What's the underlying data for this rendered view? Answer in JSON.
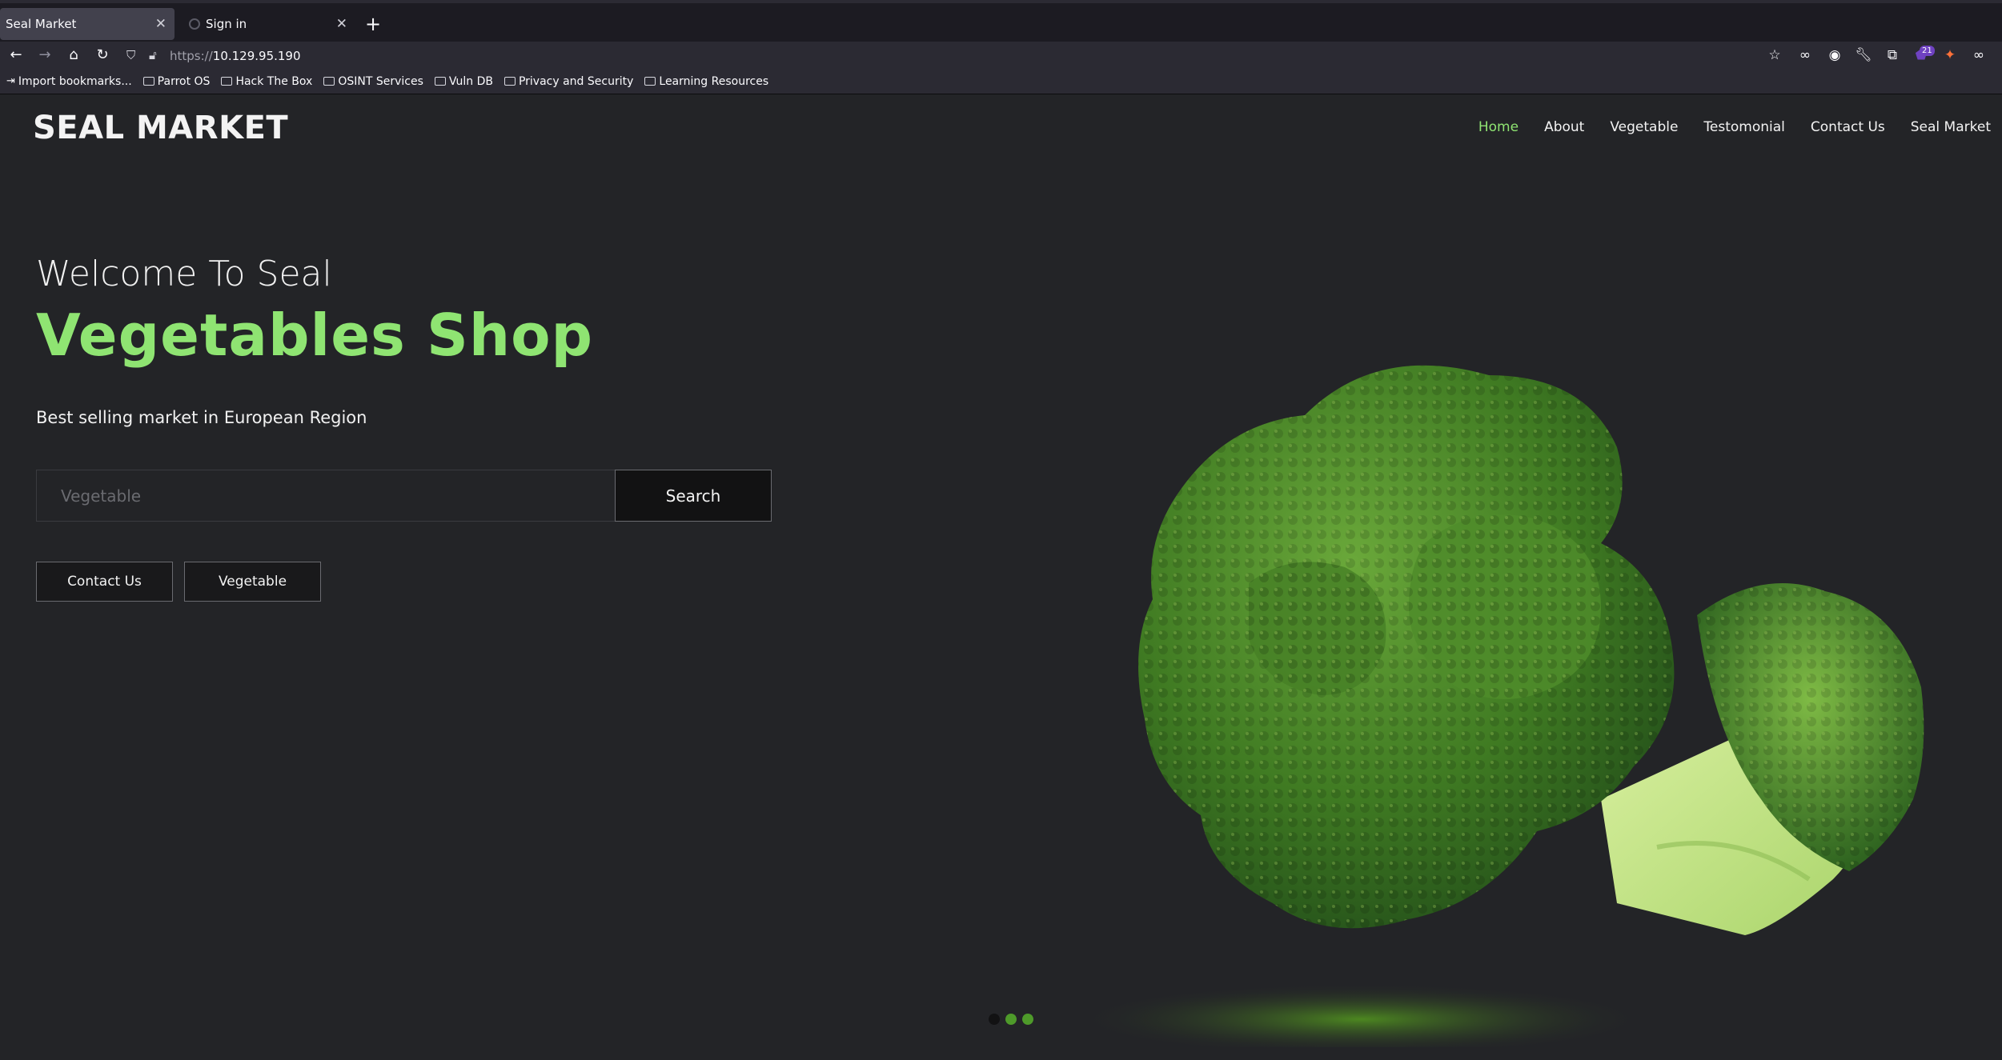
{
  "browser": {
    "tabs": [
      {
        "label": "Seal Market",
        "active": true
      },
      {
        "label": "Sign in",
        "active": false
      }
    ],
    "url_proto": "https://",
    "url_host": "10.129.95.190",
    "extension_badge": "21",
    "bookmarks": [
      {
        "label": "Import bookmarks...",
        "icon": "import-icon"
      },
      {
        "label": "Parrot OS",
        "icon": "folder-icon"
      },
      {
        "label": "Hack The Box",
        "icon": "folder-icon"
      },
      {
        "label": "OSINT Services",
        "icon": "folder-icon"
      },
      {
        "label": "Vuln DB",
        "icon": "folder-icon"
      },
      {
        "label": "Privacy and Security",
        "icon": "folder-icon"
      },
      {
        "label": "Learning Resources",
        "icon": "folder-icon"
      }
    ]
  },
  "site": {
    "logo": "SEAL MARKET",
    "nav": [
      "Home",
      "About",
      "Vegetable",
      "Testomonial",
      "Contact Us",
      "Seal Market"
    ],
    "nav_active": "Home",
    "welcome": "Welcome To Seal",
    "headline": "Vegetables Shop",
    "tagline": "Best selling market in European Region",
    "search_placeholder": "Vegetable",
    "search_button": "Search",
    "contact_button": "Contact Us",
    "vegetable_button": "Vegetable",
    "slider_dots": 3,
    "slider_active": 1
  },
  "colors": {
    "accent": "#8fe472",
    "page_bg": "#232427",
    "browser_bg": "#1c1b22"
  }
}
